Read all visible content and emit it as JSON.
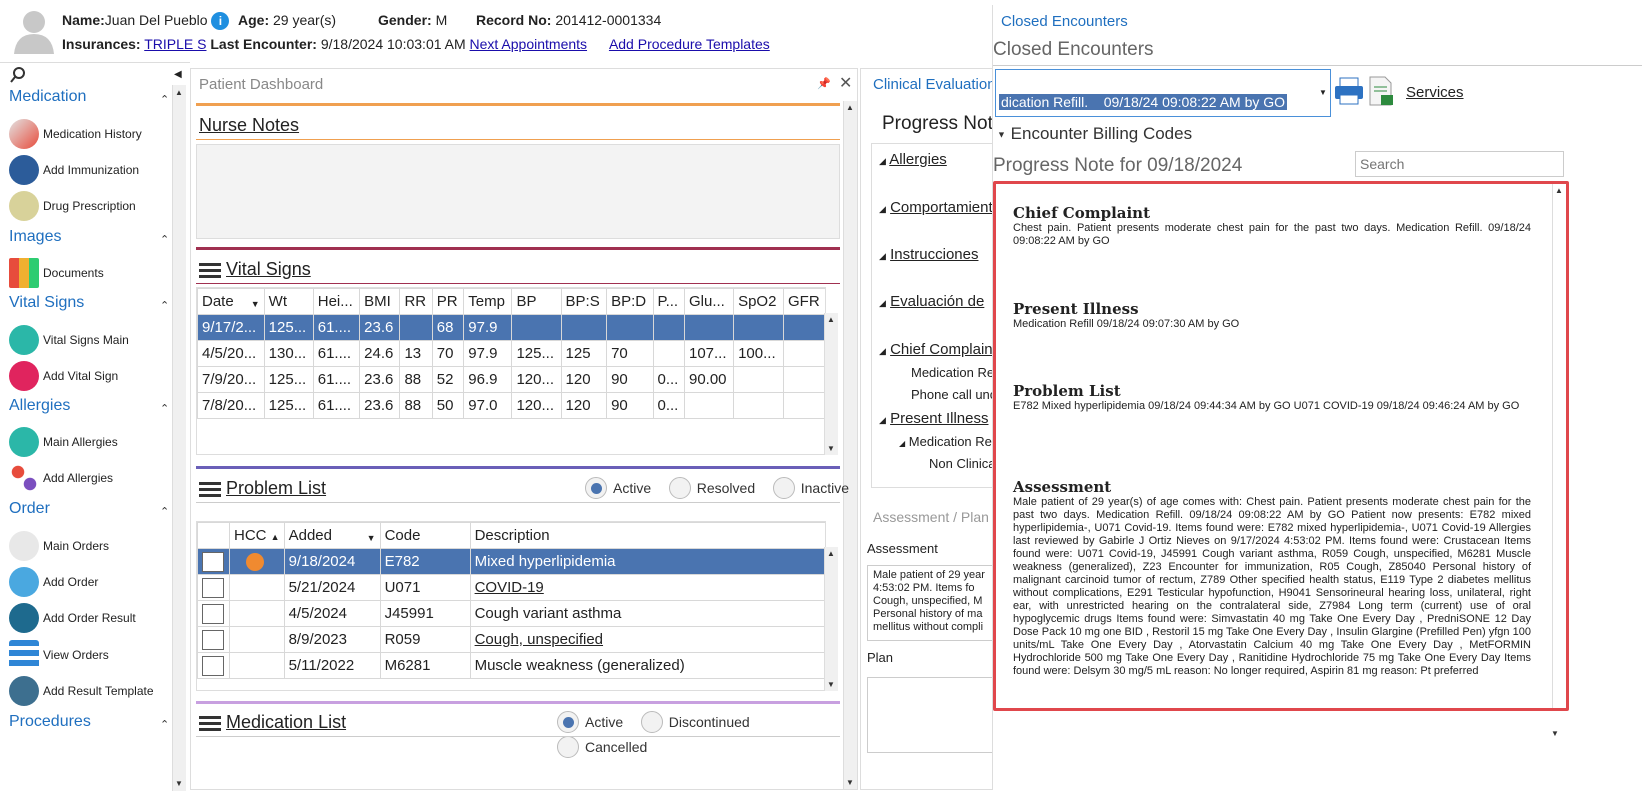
{
  "header": {
    "name_label": "Name:",
    "name": "Juan Del Pueblo",
    "age_label": "Age:",
    "age": "29 year(s)",
    "gender_label": "Gender:",
    "gender": "M",
    "record_label": "Record No:",
    "record": "201412-0001334",
    "insurances_label": "Insurances:",
    "insurance": "TRIPLE S",
    "last_enc_label": "Last Encounter:",
    "last_enc": "9/18/2024 10:03:01 AM",
    "next_appts": "Next Appointments",
    "add_templates": "Add Procedure Templates"
  },
  "sidebar": {
    "sections": [
      {
        "title": "Medication",
        "items": [
          "Medication History",
          "Add Immunization",
          "Drug Prescription"
        ]
      },
      {
        "title": "Images",
        "items": [
          "Documents"
        ]
      },
      {
        "title": "Vital Signs",
        "items": [
          "Vital Signs Main",
          "Add Vital Sign"
        ]
      },
      {
        "title": "Allergies",
        "items": [
          "Main Allergies",
          "Add Allergies"
        ]
      },
      {
        "title": "Order",
        "items": [
          "Main Orders",
          "Add Order",
          "Add Order Result",
          "View Orders",
          "Add Result Template"
        ]
      },
      {
        "title": "Procedures",
        "items": []
      }
    ]
  },
  "dashboard": {
    "title": "Patient Dashboard",
    "nurse_notes": "Nurse Notes",
    "vital_signs": "Vital Signs",
    "vitals_cols": [
      "Date",
      "Wt",
      "Hei...",
      "BMI",
      "RR",
      "PR",
      "Temp",
      "BP",
      "BP:S",
      "BP:D",
      "P...",
      "Glu...",
      "SpO2",
      "GFR"
    ],
    "vitals_rows": [
      [
        "9/17/2...",
        "125...",
        "61....",
        "23.6",
        "",
        "68",
        "97.9",
        "",
        "",
        "",
        "",
        "",
        "",
        ""
      ],
      [
        "4/5/20...",
        "130...",
        "61....",
        "24.6",
        "13",
        "70",
        "97.9",
        "125...",
        "125",
        "70",
        "",
        "107...",
        "100...",
        ""
      ],
      [
        "7/9/20...",
        "125...",
        "61....",
        "23.6",
        "88",
        "52",
        "96.9",
        "120...",
        "120",
        "90",
        "0...",
        "90.00",
        "",
        ""
      ],
      [
        "7/8/20...",
        "125...",
        "61....",
        "23.6",
        "88",
        "50",
        "97.0",
        "120...",
        "120",
        "90",
        "0...",
        "",
        "",
        ""
      ]
    ],
    "problem_list": "Problem List",
    "problem_filters": [
      "Active",
      "Resolved",
      "Inactive"
    ],
    "problem_cols": [
      "",
      "HCC",
      "Added",
      "Code",
      "Description"
    ],
    "problem_rows": [
      {
        "added": "9/18/2024",
        "code": "E782",
        "desc": "Mixed hyperlipidemia"
      },
      {
        "added": "5/21/2024",
        "code": "U071",
        "desc": "COVID-19"
      },
      {
        "added": "4/5/2024",
        "code": "J45991",
        "desc": "Cough variant asthma"
      },
      {
        "added": "8/9/2023",
        "code": "R059",
        "desc": "Cough, unspecified"
      },
      {
        "added": "5/11/2022",
        "code": "M6281",
        "desc": "Muscle weakness (generalized)"
      }
    ],
    "medication_list": "Medication List",
    "med_filters": [
      "Active",
      "Discontinued",
      "Cancelled"
    ]
  },
  "clinical": {
    "title": "Clinical Evaluation",
    "progress_note": "Progress Note",
    "tree": [
      "Allergies",
      "Comportamiento",
      "Instrucciones",
      "Evaluación de",
      "Chief Complaint",
      "Medication Re",
      "Phone call unc",
      "Present Illness",
      "Medication Re",
      "Non Clinical"
    ],
    "assessment_plan": "Assessment / Plan",
    "assessment_label": "Assessment",
    "assessment_text": "Male patient of 29 year 4:53:02 PM. Items fo Cough, unspecified, M Personal history of ma mellitus without compli",
    "plan_label": "Plan"
  },
  "closed": {
    "tab_title": "Closed Encounters",
    "header": "Closed Encounters",
    "selected_encounter": "dication Refill.    09/18/24 09:08:22 AM by GO",
    "services": "Services",
    "billing_codes": "Encounter Billing Codes",
    "progress_for": "Progress Note for 09/18/2024",
    "search_placeholder": "Search",
    "note": {
      "cc_title": "Chief Complaint",
      "cc_text": "Chest pain. Patient presents moderate chest pain for the past two days. Medication Refill. 09/18/24 09:08:22 AM by GO",
      "pi_title": "Present Illness",
      "pi_text": "Medication Refill 09/18/24 09:07:30 AM by GO",
      "pl_title": "Problem List",
      "pl_text": "E782 Mixed hyperlipidemia 09/18/24 09:44:34 AM by GO U071 COVID-19 09/18/24 09:46:24 AM by GO",
      "as_title": "Assessment",
      "as_text": "Male patient of 29 year(s) of age comes with: Chest pain. Patient presents moderate chest pain for the past two days. Medication Refill. 09/18/24 09:08:22 AM by GO Patient now presents: E782 mixed hyperlipidemia-, U071 Covid-19. Items found were: E782 mixed hyperlipidemia-, U071 Covid-19 Allergies last reviewed by Gabirle J Ortiz Nieves on 9/17/2024 4:53:02 PM. Items found were: Crustacean Items found were: U071 Covid-19, J45991 Cough variant asthma, R059 Cough, unspecified, M6281 Muscle weakness (generalized), Z23 Encounter for immunization, R05 Cough, Z85040 Personal history of malignant carcinoid tumor of rectum, Z789 Other specified health status, E119 Type 2 diabetes mellitus without complications, E291 Testicular hypofunction, H9041 Sensorineural hearing loss, unilateral, right ear, with unrestricted hearing on the contralateral side, Z7984 Long term (current) use of oral hypoglycemic drugs Items found were: Simvastatin 40 mg Take One Every Day , PredniSONE 12 Day Dose Pack 10 mg one BID , Restoril 15 mg Take One Every Day , Insulin Glargine (Prefilled Pen) yfgn 100 units/mL Take One Every Day , Atorvastatin Calcium 40 mg Take One Every Day , MetFORMIN Hydrochloride 500 mg Take One Every Day , Ranitidine Hydrochloride 75 mg Take One Every Day Items found were: Delsym 30 mg/5 mL reason: No longer required, Aspirin 81 mg reason: Pt preferred"
    }
  }
}
